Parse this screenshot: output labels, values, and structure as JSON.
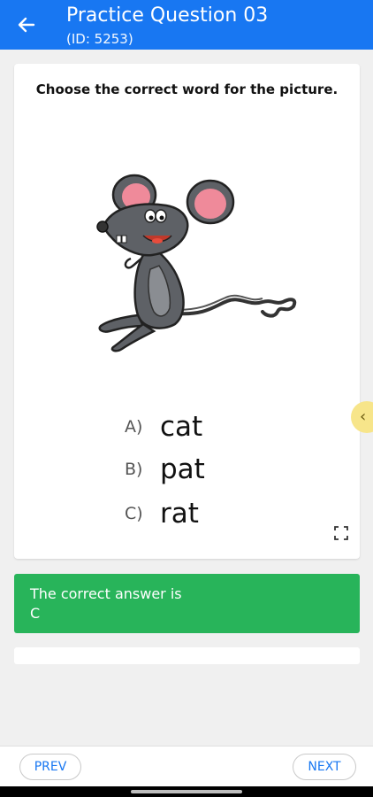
{
  "header": {
    "title": "Practice Question 03",
    "subtitle": "(ID: 5253)",
    "background": "#1877f2"
  },
  "question": {
    "prompt": "Choose the correct word for the picture.",
    "image_icon": "cartoon-mouse",
    "options": [
      {
        "letter": "A)",
        "word": "cat"
      },
      {
        "letter": "B)",
        "word": "pat"
      },
      {
        "letter": "C)",
        "word": "rat"
      }
    ]
  },
  "answer": {
    "line1": "The correct answer is",
    "line2": "C",
    "background": "#28b45a"
  },
  "side_tab": {
    "glyph": "‹"
  },
  "navigation": {
    "prev_label": "PREV",
    "next_label": "NEXT"
  }
}
